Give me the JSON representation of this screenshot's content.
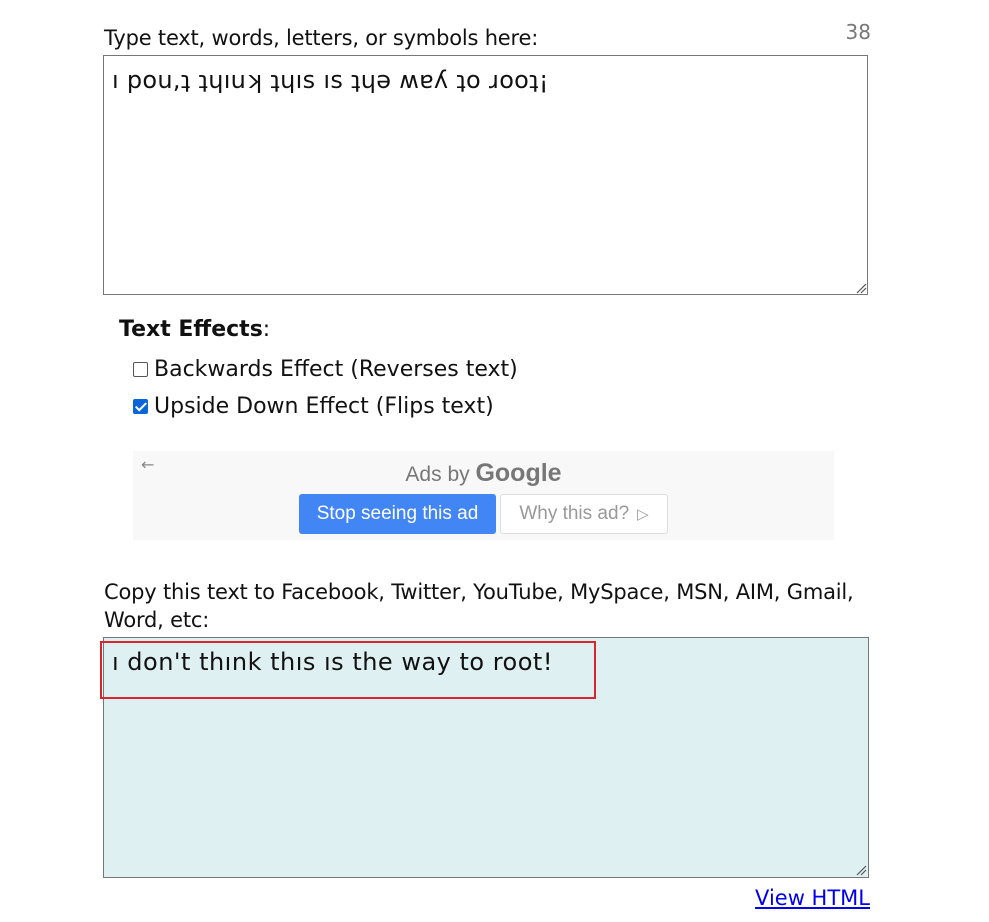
{
  "input": {
    "char_count": "38",
    "label": "Type text, words, letters, or symbols here:",
    "value": "ı pou,ʇ ʇɥıuʞ ʇɥıs ıs ʇɥǝ ʍɐʎ ʇo ɹooʇ¡"
  },
  "effects": {
    "title": "Text Effects",
    "title_suffix": ":",
    "options": [
      {
        "label": "Backwards Effect (Reverses text)",
        "checked": false
      },
      {
        "label": "Upside Down Effect (Flips text)",
        "checked": true
      }
    ]
  },
  "ad": {
    "back_icon": "←",
    "ads_by": "Ads by",
    "brand": "Google",
    "stop_label": "Stop seeing this ad",
    "why_label": "Why this ad?",
    "why_icon": "▷"
  },
  "output": {
    "label": "Copy this text to Facebook, Twitter, YouTube, MySpace, MSN, AIM, Gmail, Word, etc:",
    "value": "ı don't thınk thıs ıs the way to root!",
    "view_html": "View HTML"
  },
  "colors": {
    "checkbox_checked": "#0a66d8",
    "ad_button": "#4285f4",
    "output_bg": "#dff0f3",
    "highlight_border": "#d9252b"
  }
}
